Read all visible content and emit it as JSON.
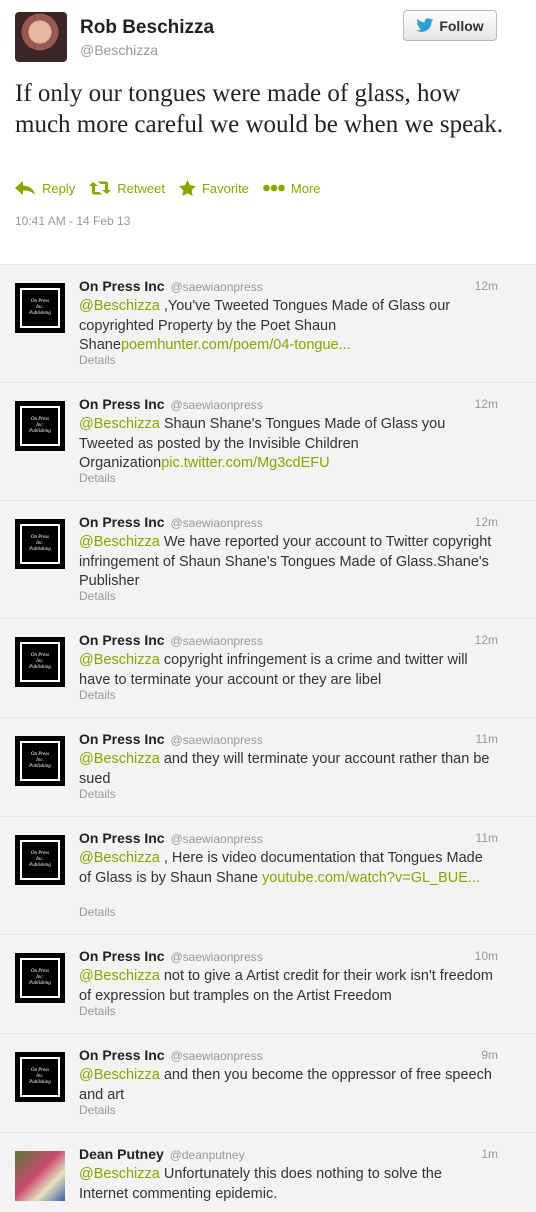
{
  "main_tweet": {
    "name": "Rob Beschizza",
    "handle": "@Beschizza",
    "follow_label": "Follow",
    "text": "If only our tongues were made of glass, how much more careful we would be when we speak.",
    "actions": {
      "reply": "Reply",
      "retweet": "Retweet",
      "favorite": "Favorite",
      "more": "More"
    },
    "timestamp": "10:41 AM - 14 Feb 13"
  },
  "avatar_plate_text": [
    "On Press",
    "Inc.",
    "Publishing"
  ],
  "details_label": "Details",
  "replies": [
    {
      "name": "On Press Inc",
      "handle": "@saewiaonpress",
      "time": "12m",
      "mention": "@Beschizza",
      "text": " ,You've Tweeted Tongues Made of Glass our copyrighted Property by the Poet Shaun Shane",
      "link": "poemhunter.com/poem/04-tongue..."
    },
    {
      "name": "On Press Inc",
      "handle": "@saewiaonpress",
      "time": "12m",
      "mention": "@Beschizza",
      "text": " Shaun Shane's Tongues Made of Glass you Tweeted as posted by the Invisible Children Organization",
      "link": "pic.twitter.com/Mg3cdEFU"
    },
    {
      "name": "On Press Inc",
      "handle": "@saewiaonpress",
      "time": "12m",
      "mention": "@Beschizza",
      "text": " We have reported your account to Twitter copyright infringement of Shaun Shane's Tongues Made of Glass.Shane's Publisher",
      "link": ""
    },
    {
      "name": "On Press Inc",
      "handle": "@saewiaonpress",
      "time": "12m",
      "mention": "@Beschizza",
      "text": " copyright infringement is a crime and twitter will have to terminate your account or they are libel",
      "link": ""
    },
    {
      "name": "On Press Inc",
      "handle": "@saewiaonpress",
      "time": "11m",
      "mention": "@Beschizza",
      "text": " and they will terminate your account rather than be sued",
      "link": ""
    },
    {
      "name": "On Press Inc",
      "handle": "@saewiaonpress",
      "time": "11m",
      "mention": "@Beschizza",
      "text": " , Here is video documentation that Tongues Made of Glass is by Shaun Shane ",
      "link": "youtube.com/watch?v=GL_BUE..."
    },
    {
      "name": "On Press Inc",
      "handle": "@saewiaonpress",
      "time": "10m",
      "mention": "@Beschizza",
      "text": " not to give a Artist credit for their work isn't freedom of expression but tramples on the Artist Freedom",
      "link": ""
    },
    {
      "name": "On Press Inc",
      "handle": "@saewiaonpress",
      "time": "9m",
      "mention": "@Beschizza",
      "text": " and then you become the oppressor of free speech and art",
      "link": ""
    },
    {
      "name": "Dean Putney",
      "handle": "@deanputney",
      "time": "1m",
      "mention": "@Beschizza",
      "text": " Unfortunately this does nothing to solve the Internet commenting epidemic.",
      "link": ""
    }
  ],
  "colors": {
    "accent": "#8ba400",
    "muted": "#999999",
    "reply_bg": "#f3f3f3",
    "follow_bird": "#2b9fd6"
  }
}
